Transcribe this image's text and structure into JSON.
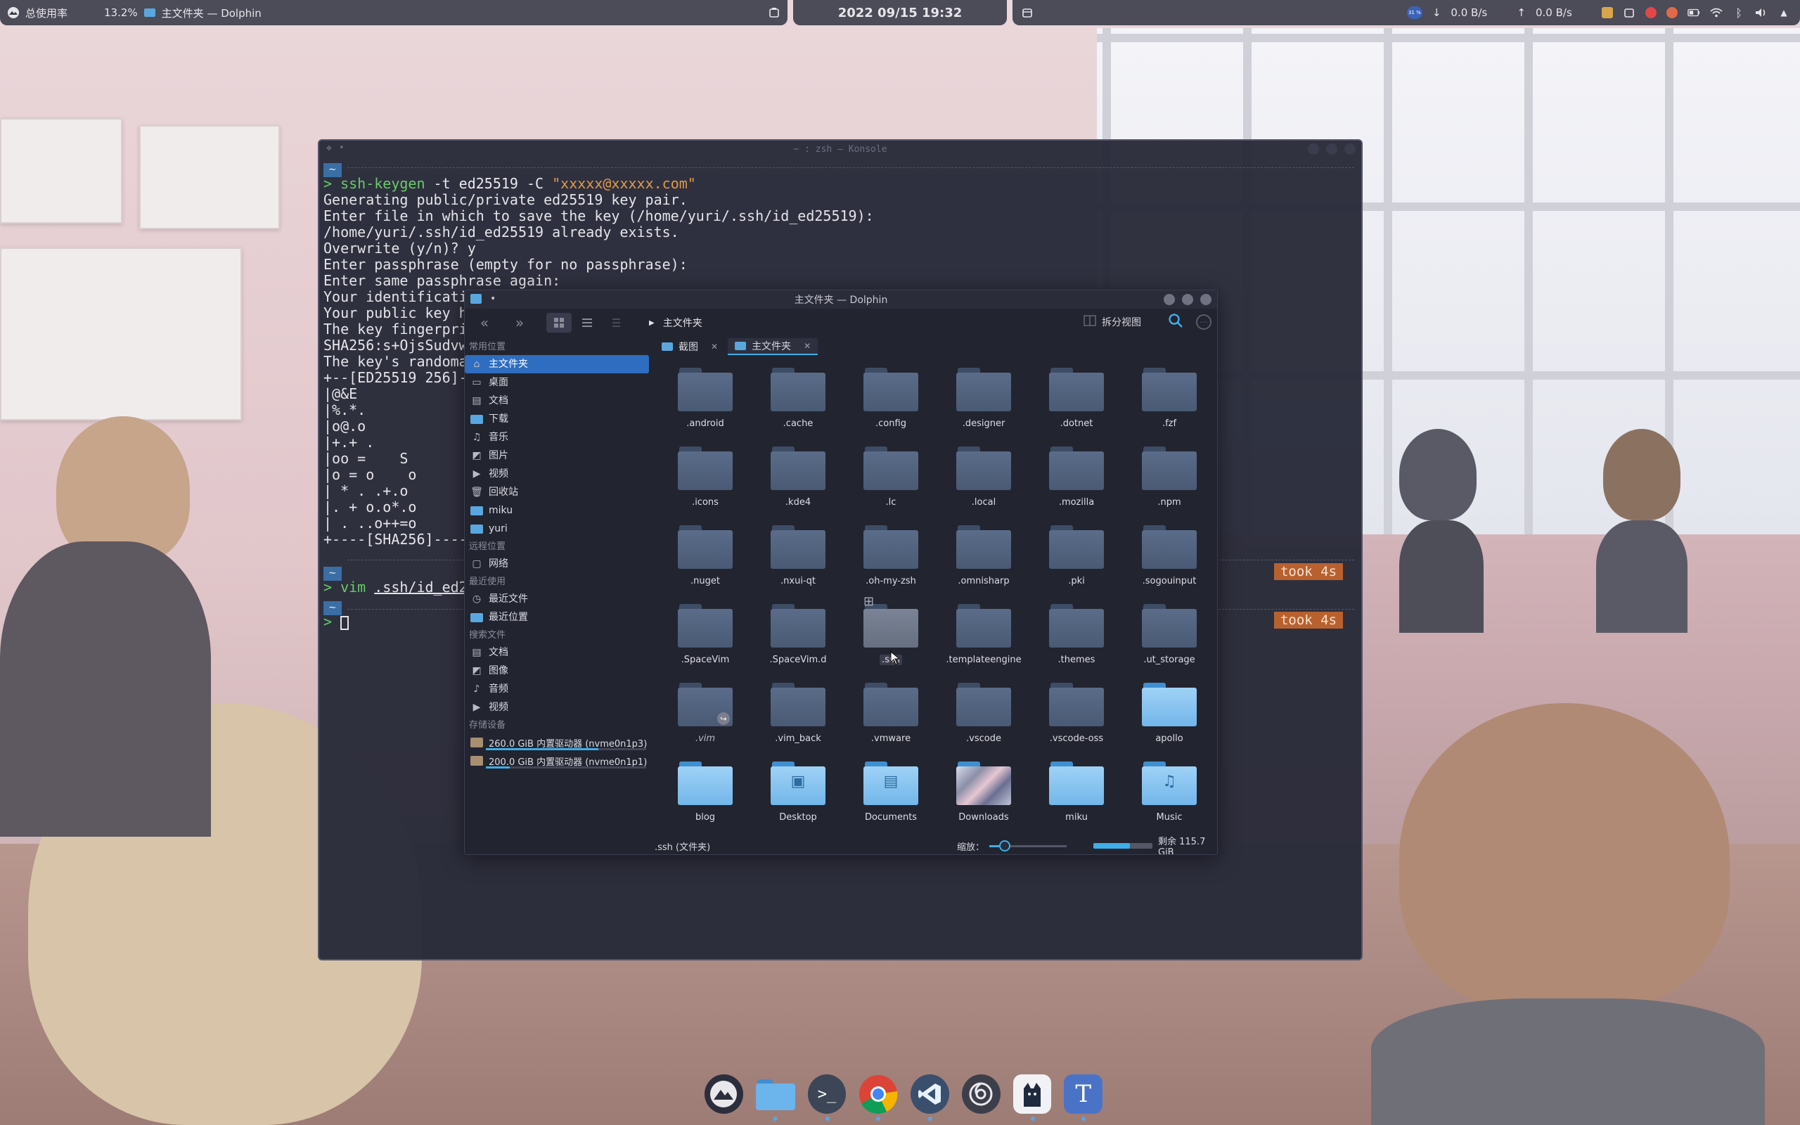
{
  "topbar": {
    "cpu_label": "总使用率",
    "cpu_value": "13.2%",
    "active_window": "主文件夹 — Dolphin",
    "datetime": "2022 09/15 19:32",
    "net_down": "0.0 B/s",
    "net_up": "0.0 B/s",
    "battery_badge": "31 %",
    "down_arrow": "↓",
    "up_arrow": "↑"
  },
  "konsole": {
    "title": "~ : zsh — Konsole",
    "prompt_tag": "~",
    "lines": [
      "Generating public/private ed25519 key pair.",
      "Enter file in which to save the key (/home/yuri/.ssh/id_ed25519):",
      "/home/yuri/.ssh/id_ed25519 already exists.",
      "Overwrite (y/n)? y",
      "Enter passphrase (empty for no passphrase):",
      "Enter same passphrase again:",
      "Your identificatio",
      "Your public key ha",
      "The key fingerprin",
      "SHA256:s+OjsSudvwm",
      "The key's randomar",
      "+--[ED25519 256]--",
      "|@&E",
      "|%.*.",
      "|o@.o",
      "|+.+ .",
      "|oo =    S",
      "|o = o    o",
      "| * . .+.o",
      "|. + o.o*.o",
      "| . ..o++=o",
      "+----[SHA256]-----"
    ],
    "cmd1_name": "ssh-keygen",
    "cmd1_args": " -t ed25519 -C ",
    "cmd1_str": "\"xxxxx@xxxxx.com\"",
    "cmd2_name": "vim",
    "cmd2_path": ".ssh/id_ed25",
    "prompt_char": ">",
    "took_1": "took 4s",
    "took_2": "took 4s"
  },
  "dolphin": {
    "title": "主文件夹 — Dolphin",
    "breadcrumb": "主文件夹",
    "split_label": "拆分视图",
    "tabs": [
      {
        "label": "截图",
        "close": "✕"
      },
      {
        "label": "主文件夹",
        "close": "✕"
      }
    ],
    "sidebar": {
      "sections": [
        {
          "heading": "常用位置",
          "items": [
            "主文件夹",
            "桌面",
            "文档",
            "下载",
            "音乐",
            "图片",
            "视频",
            "回收站",
            "miku",
            "yuri"
          ]
        },
        {
          "heading": "远程位置",
          "items": [
            "网络"
          ]
        },
        {
          "heading": "最近使用",
          "items": [
            "最近文件",
            "最近位置"
          ]
        },
        {
          "heading": "搜索文件",
          "items": [
            "文档",
            "图像",
            "音频",
            "视频"
          ]
        },
        {
          "heading": "存储设备",
          "items": []
        }
      ],
      "devices": [
        {
          "label": "260.0 GiB 内置驱动器 (nvme0n1p3)",
          "used_fraction": 0.7
        },
        {
          "label": "200.0 GiB 内置驱动器 (nvme0n1p1)",
          "used_fraction": 0.15
        }
      ]
    },
    "files": [
      ".android",
      ".cache",
      ".config",
      ".designer",
      ".dotnet",
      ".fzf",
      ".icons",
      ".kde4",
      ".lc",
      ".local",
      ".mozilla",
      ".npm",
      ".nuget",
      ".nxui-qt",
      ".oh-my-zsh",
      ".omnisharp",
      ".pki",
      ".sogouinput",
      ".SpaceVim",
      ".SpaceVim.d",
      ".ssh",
      ".templateengine",
      ".themes",
      ".ut_storage",
      ".vim",
      ".vim_back",
      ".vmware",
      ".vscode",
      ".vscode-oss",
      "apollo",
      "blog",
      "Desktop",
      "Documents",
      "Downloads",
      "miku",
      "Music"
    ],
    "status_text": ".ssh (文件夹)",
    "zoom_label": "缩放：",
    "zoom_fraction": 0.2,
    "free_fraction": 0.62,
    "free_label": "剩余 115.7 GiB"
  },
  "dock": {
    "apps": [
      "mountain-launcher",
      "files",
      "terminal",
      "chrome",
      "vscode",
      "nekoray",
      "cat",
      "typora"
    ]
  },
  "colors": {
    "accent": "#3daee9",
    "selection": "#2e6dbf",
    "took_badge": "#b9612e",
    "prompt_green": "#66cc66"
  }
}
